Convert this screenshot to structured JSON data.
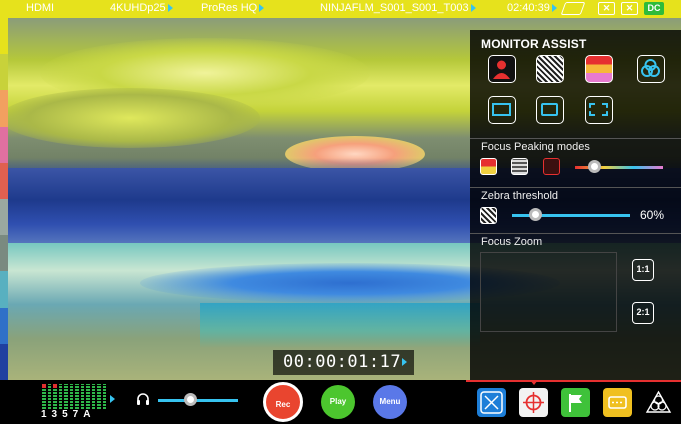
{
  "top_bar": {
    "input": "HDMI",
    "format": "4KUHDp25",
    "codec": "ProRes HQ",
    "clip_name": "NINJAFLM_S001_S001_T003",
    "time": "02:40:39",
    "power_badge": "DC"
  },
  "timecode": "00:00:01:17",
  "monitor_assist": {
    "title": "MONITOR ASSIST",
    "focus_peaking_label": "Focus Peaking modes",
    "zebra_label": "Zebra threshold",
    "zebra_value": "60%",
    "focus_zoom_label": "Focus Zoom",
    "zoom_1": "1:1",
    "zoom_2": "2:1"
  },
  "bottom_bar": {
    "meter_labels": "1357A",
    "rec_label": "Rec",
    "play_label": "Play",
    "menu_label": "Menu"
  },
  "colors": {
    "top_bar": "#e6e21c",
    "accent": "#37c3ef",
    "rec": "#e9452f",
    "play": "#4cc62e",
    "menu": "#5a78e8"
  }
}
